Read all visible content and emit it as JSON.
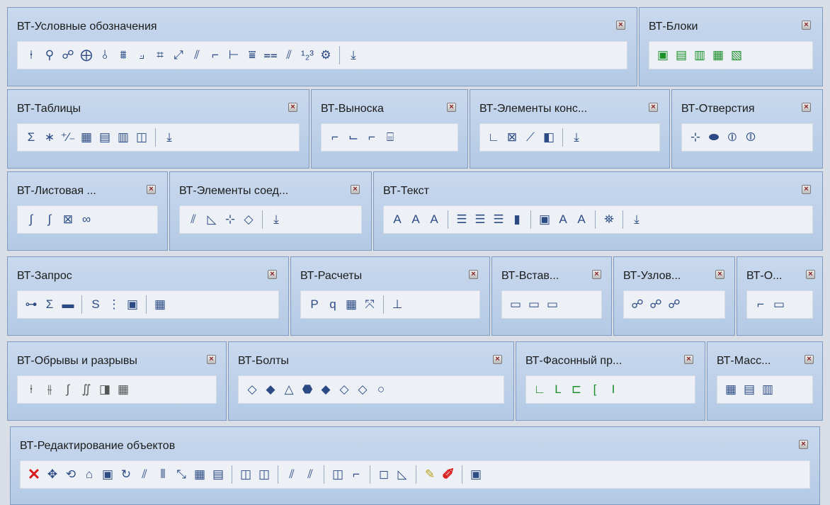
{
  "colors": {
    "toolbar_bg": "#bed2ea",
    "toolbar_border": "#7f9bc2",
    "icon_strip_bg": "#edf1f6",
    "icon_blue": "#2c4b84",
    "icon_red": "#d81c1c"
  },
  "close_glyph": "×",
  "toolbars": {
    "uslovnye": {
      "title": "ВТ-Условные обозначения"
    },
    "bloki": {
      "title": "ВТ-Блоки"
    },
    "tablitsy": {
      "title": "ВТ-Таблицы"
    },
    "vynoska": {
      "title": "ВТ-Выноска"
    },
    "elementy_kons": {
      "title": "ВТ-Элементы конс..."
    },
    "otverstiya": {
      "title": "ВТ-Отверстия"
    },
    "listovaya": {
      "title": "ВТ-Листовая ..."
    },
    "elementy_soed": {
      "title": "ВТ-Элементы соед..."
    },
    "tekst": {
      "title": "ВТ-Текст"
    },
    "zapros": {
      "title": "ВТ-Запрос"
    },
    "raschety": {
      "title": "ВТ-Расчеты"
    },
    "vstav": {
      "title": "ВТ-Встав..."
    },
    "uzlov": {
      "title": "ВТ-Узлов..."
    },
    "o": {
      "title": "ВТ-О..."
    },
    "obryvy": {
      "title": "ВТ-Обрывы и разрывы"
    },
    "bolty": {
      "title": "ВТ-Болты"
    },
    "fasonny": {
      "title": "ВТ-Фасонный пр..."
    },
    "mass": {
      "title": "ВТ-Масс..."
    },
    "redaktirovanie": {
      "title": "ВТ-Редактирование объектов"
    }
  },
  "glyphs": {
    "uslovnye": [
      "⍿",
      "⚲",
      "☍",
      "⨁",
      "⫰",
      "⩩",
      "⟓",
      "⌗",
      "⤢",
      "⫽",
      "⌐",
      "⊢",
      "⩸",
      "⩵",
      "⫽",
      "¹₂³",
      "⚙",
      "⤓"
    ],
    "bloki": [
      "▣",
      "▤",
      "▥",
      "▦",
      "▧"
    ],
    "tablitsy": [
      "Σ",
      "∗",
      "⁺⁄₋",
      "▦",
      "▤",
      "▥",
      "◫",
      "⤓"
    ],
    "vynoska": [
      "⌐",
      "⌙",
      "⌐",
      "⌸"
    ],
    "elementy_kons": [
      "∟",
      "⊠",
      "⟋",
      "◧",
      "⤓"
    ],
    "otverstiya": [
      "⊹",
      "⬬",
      "⦶",
      "⦷"
    ],
    "listovaya": [
      "∫",
      "∫",
      "⊠",
      "∞"
    ],
    "elementy_soed": [
      "⫽",
      "◺",
      "⊹",
      "◇",
      "⤓"
    ],
    "tekst": [
      "A",
      "A",
      "A",
      "☰",
      "☰",
      "☰",
      "▮",
      "▣",
      "A",
      "A",
      "⛯",
      "⤓"
    ],
    "zapros": [
      "⊶",
      "Σ",
      "▬",
      "S",
      "⋮",
      "▣",
      "▦"
    ],
    "raschety": [
      "P",
      "q",
      "▦",
      "⤧",
      "⊥"
    ],
    "vstav": [
      "▭",
      "▭",
      "▭"
    ],
    "uzlov": [
      "☍",
      "☍",
      "☍"
    ],
    "o": [
      "⌐",
      "▭"
    ],
    "obryvy": [
      "⍿",
      "⫳",
      "∫",
      "∬",
      "◨",
      "▦"
    ],
    "bolty": [
      "◇",
      "◆",
      "△",
      "⬣",
      "◆",
      "◇",
      "◇",
      "○"
    ],
    "fasonny": [
      "∟",
      "L",
      "⊏",
      "[",
      "I"
    ],
    "mass": [
      "▦",
      "▤",
      "▥"
    ],
    "redaktirovanie": [
      "✕",
      "✥",
      "⟲",
      "⌂",
      "▣",
      "↻",
      "⫽",
      "⦀",
      "⤡",
      "▦",
      "▤",
      "◫",
      "◫",
      "⫽",
      "⫽",
      "◫",
      "⌐",
      "◻",
      "◺",
      "✎",
      "✐",
      "▣"
    ]
  }
}
